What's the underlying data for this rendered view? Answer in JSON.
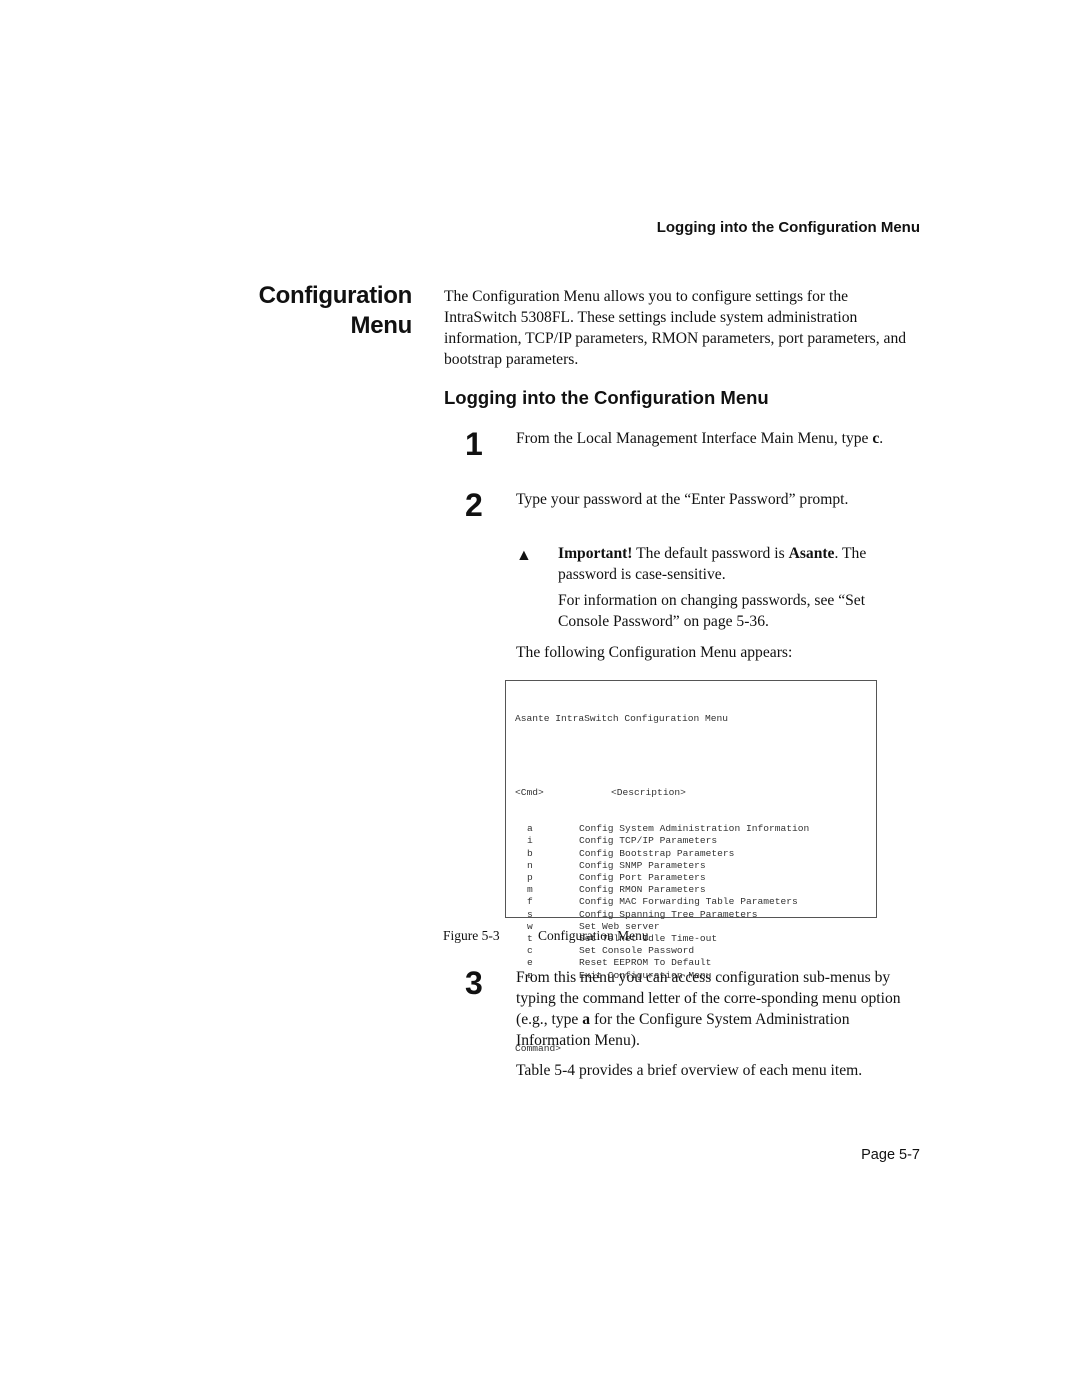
{
  "running_header": "Logging into the Configuration Menu",
  "side_heading": {
    "line1": "Configuration",
    "line2": "Menu"
  },
  "intro": "The Configuration Menu allows you to configure settings for the IntraSwitch 5308FL. These settings include system administration information, TCP/IP parameters, RMON parameters, port parameters, and bootstrap parameters.",
  "subheading": "Logging into the Configuration Menu",
  "steps": [
    {
      "number": "1",
      "text_before": "From the Local Management Interface Main Menu, type ",
      "bold": "c",
      "text_after": "."
    },
    {
      "number": "2",
      "text": "Type your password at the “Enter Password” prompt."
    },
    {
      "number": "3",
      "text_before": "From this menu you can access configuration sub-menus by typing the command letter of the corre-sponding menu option (e.g., type ",
      "bold": "a",
      "text_after": " for the Configure System Administration Information Menu).",
      "followup": "Table 5-4 provides a brief overview of each menu item."
    }
  ],
  "note": {
    "icon": "warning-triangle-icon",
    "glyph": "▲",
    "label": "Important!",
    "text1": " The default password is ",
    "password": "Asante",
    "text2": ". The password is case-sensitive.",
    "more": "For information on changing passwords, see “Set Console Password” on page 5-36."
  },
  "follows_text": "The following Configuration Menu appears:",
  "screen": {
    "title": "Asante IntraSwitch Configuration Menu",
    "col_cmd": "<Cmd>",
    "col_desc": "<Description>",
    "items": [
      {
        "key": "a",
        "desc": "Config System Administration Information"
      },
      {
        "key": "i",
        "desc": "Config TCP/IP Parameters"
      },
      {
        "key": "b",
        "desc": "Config Bootstrap Parameters"
      },
      {
        "key": "n",
        "desc": "Config SNMP Parameters"
      },
      {
        "key": "p",
        "desc": "Config Port Parameters"
      },
      {
        "key": "m",
        "desc": "Config RMON Parameters"
      },
      {
        "key": "f",
        "desc": "Config MAC Forwarding Table Parameters"
      },
      {
        "key": "s",
        "desc": "Config Spanning Tree Parameters"
      },
      {
        "key": "w",
        "desc": "Set Web server"
      },
      {
        "key": "t",
        "desc": "Set Telnet Idle Time-out"
      },
      {
        "key": "c",
        "desc": "Set Console Password"
      },
      {
        "key": "e",
        "desc": "Reset EEPROM To Default"
      },
      {
        "key": "q",
        "desc": "Exit Configuration Menu"
      }
    ],
    "prompt": "Command>"
  },
  "caption": {
    "label": "Figure 5-3",
    "title": "Configuration Menu"
  },
  "page_number": "Page 5-7"
}
